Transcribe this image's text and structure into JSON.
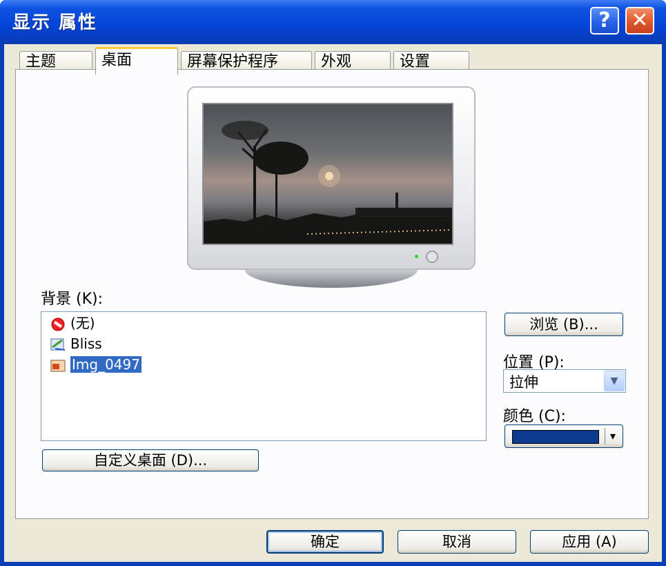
{
  "window": {
    "title": "显示 属性",
    "help_label": "?",
    "close_label": "✕",
    "accent": "#0a3fb6",
    "tab_active_stripe": "#ffc83c"
  },
  "tabs": [
    {
      "label": "主题",
      "active": false
    },
    {
      "label": "桌面",
      "active": true
    },
    {
      "label": "屏幕保护程序",
      "active": false
    },
    {
      "label": "外观",
      "active": false
    },
    {
      "label": "设置",
      "active": false
    }
  ],
  "desktop": {
    "preview_icon": "monitor-preview-icon",
    "background_label": "背景 (K):",
    "background_items": [
      {
        "label": "(无)",
        "icon": "no-entry-icon",
        "selected": false
      },
      {
        "label": "Bliss",
        "icon": "image-file-icon",
        "selected": false
      },
      {
        "label": "Img_0497",
        "icon": "jpeg-file-icon",
        "selected": true
      }
    ],
    "browse_button": "浏览 (B)...",
    "position_label": "位置 (P):",
    "position_value": "拉伸",
    "color_label": "颜色 (C):",
    "color_value": "#0b3a8e",
    "customize_button": "自定义桌面 (D)..."
  },
  "footer": {
    "ok_button": "确定",
    "cancel_button": "取消",
    "apply_button": "应用 (A)"
  }
}
